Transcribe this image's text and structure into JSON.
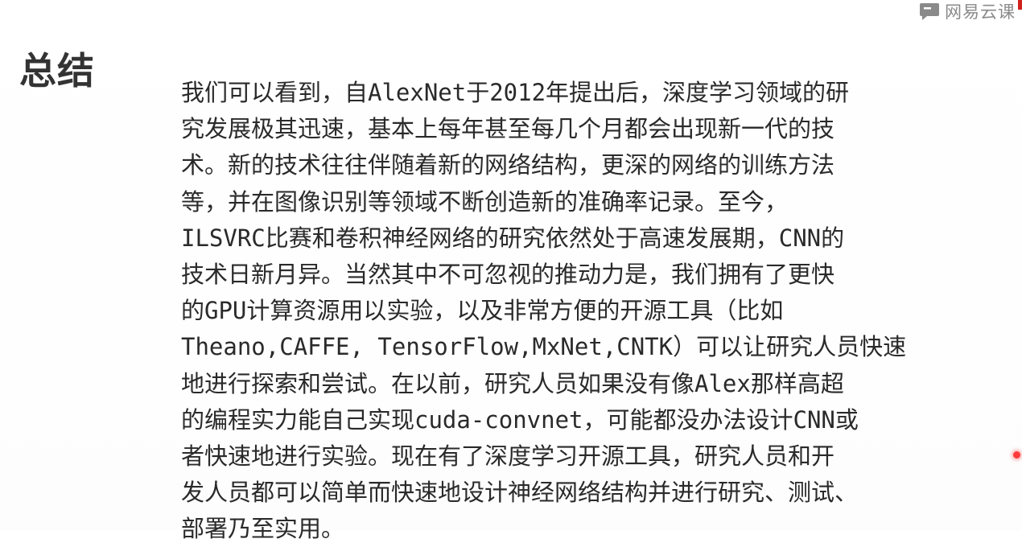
{
  "watermark": {
    "text": "网易云课",
    "icon": "chat-bubble-logo-icon"
  },
  "slide": {
    "title": "总结",
    "paragraph_lines": [
      "我们可以看到，自AlexNet于2012年提出后，深度学习领域的研",
      "究发展极其迅速，基本上每年甚至每几个月都会出现新一代的技",
      "术。新的技术往往伴随着新的网络结构，更深的网络的训练方法",
      "等，并在图像识别等领域不断创造新的准确率记录。至今，",
      "ILSVRC比赛和卷积神经网络的研究依然处于高速发展期，CNN的",
      "技术日新月异。当然其中不可忽视的推动力是，我们拥有了更快",
      "的GPU计算资源用以实验，以及非常方便的开源工具（比如",
      "Theano,CAFFE, TensorFlow,MxNet,CNTK）可以让研究人员快速",
      "地进行探索和尝试。在以前，研究人员如果没有像Alex那样高超",
      "的编程实力能自己实现cuda-convnet，可能都没办法设计CNN或",
      "者快速地进行实验。现在有了深度学习开源工具，研究人员和开",
      "发人员都可以简单而快速地设计神经网络结构并进行研究、测试、",
      "部署乃至实用。"
    ]
  },
  "colors": {
    "title": "#333333",
    "body": "#2a2a2a",
    "watermark": "#8a8a8a",
    "pointer": "#ff3b3b"
  }
}
